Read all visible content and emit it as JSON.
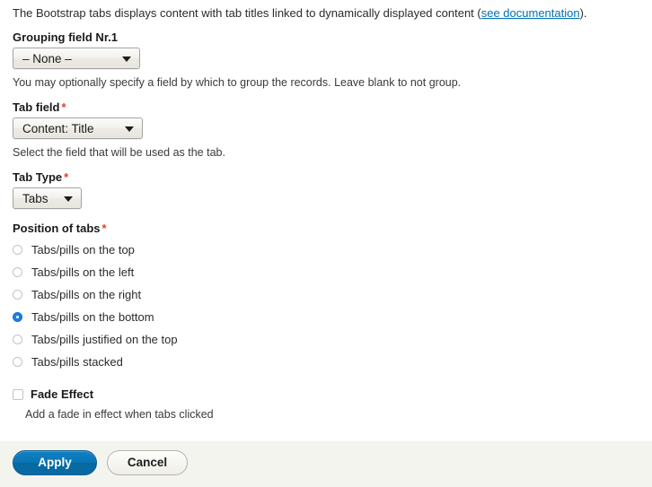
{
  "intro": {
    "text_before": "The Bootstrap tabs displays content with tab titles linked to dynamically displayed content (",
    "link_label": "see documentation",
    "text_after": ")."
  },
  "fields": {
    "grouping": {
      "label": "Grouping field Nr.1",
      "value": "– None –",
      "description": "You may optionally specify a field by which to group the records. Leave blank to not group.",
      "options": [
        "– None –"
      ]
    },
    "tab_field": {
      "label": "Tab field",
      "required_marker": "*",
      "value": "Content: Title",
      "description": "Select the field that will be used as the tab.",
      "options": [
        "Content: Title"
      ]
    },
    "tab_type": {
      "label": "Tab Type",
      "required_marker": "*",
      "value": "Tabs",
      "options": [
        "Tabs"
      ]
    },
    "position": {
      "label": "Position of tabs",
      "required_marker": "*",
      "options": [
        {
          "label": "Tabs/pills on the top",
          "checked": false
        },
        {
          "label": "Tabs/pills on the left",
          "checked": false
        },
        {
          "label": "Tabs/pills on the right",
          "checked": false
        },
        {
          "label": "Tabs/pills on the bottom",
          "checked": true
        },
        {
          "label": "Tabs/pills justified on the top",
          "checked": false
        },
        {
          "label": "Tabs/pills stacked",
          "checked": false
        }
      ]
    },
    "fade_effect": {
      "label": "Fade Effect",
      "checked": false,
      "description": "Add a fade in effect when tabs clicked"
    }
  },
  "actions": {
    "apply_label": "Apply",
    "cancel_label": "Cancel"
  },
  "colors": {
    "link": "#0071b3",
    "required": "#e23e2a",
    "radio_selected": "#1b7fe0",
    "apply_button": "#0a74b4",
    "footer_bg": "#f4f4ef"
  }
}
